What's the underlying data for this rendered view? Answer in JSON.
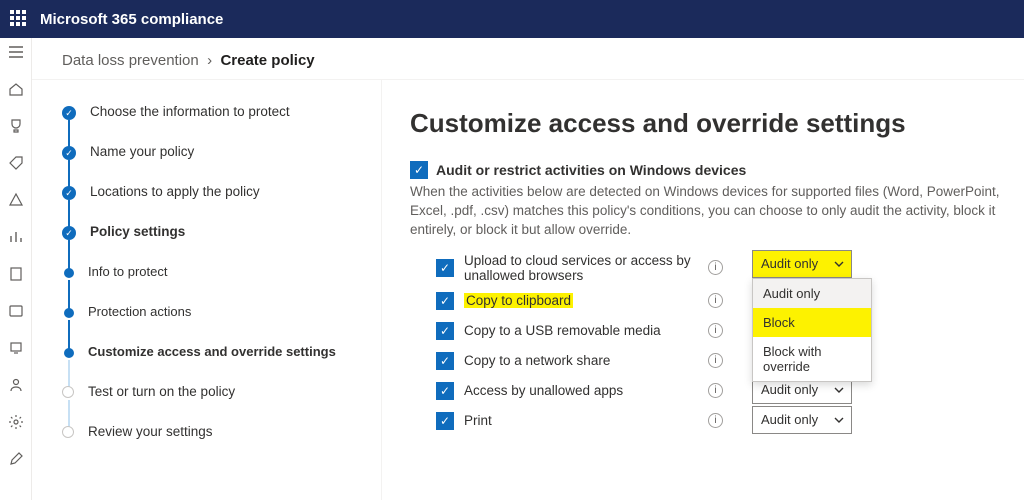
{
  "topbar": {
    "title": "Microsoft 365 compliance"
  },
  "breadcrumb": {
    "parent": "Data loss prevention",
    "sep": "›",
    "current": "Create policy"
  },
  "wizard": {
    "steps": [
      {
        "label": "Choose the information to protect"
      },
      {
        "label": "Name your policy"
      },
      {
        "label": "Locations to apply the policy"
      },
      {
        "label": "Policy settings"
      },
      {
        "label": "Info to protect"
      },
      {
        "label": "Protection actions"
      },
      {
        "label": "Customize access and override settings"
      },
      {
        "label": "Test or turn on the policy"
      },
      {
        "label": "Review your settings"
      }
    ]
  },
  "main": {
    "heading": "Customize access and override settings",
    "audit_label": "Audit or restrict activities on Windows devices",
    "audit_desc": "When the activities below are detected on Windows devices for supported files (Word, PowerPoint, Excel, .pdf, .csv) matches this policy's conditions, you can choose to only audit the activity, block it entirely, or block it but allow override.",
    "activities": [
      {
        "label": "Upload to cloud services or access by unallowed browsers",
        "select": "Audit only"
      },
      {
        "label": "Copy to clipboard"
      },
      {
        "label": "Copy to a USB removable media"
      },
      {
        "label": "Copy to a network share"
      },
      {
        "label": "Access by unallowed apps",
        "select": "Audit only"
      },
      {
        "label": "Print",
        "select": "Audit only"
      }
    ],
    "dropdown": {
      "opt1": "Audit only",
      "opt2": "Block",
      "opt3": "Block with override"
    }
  }
}
